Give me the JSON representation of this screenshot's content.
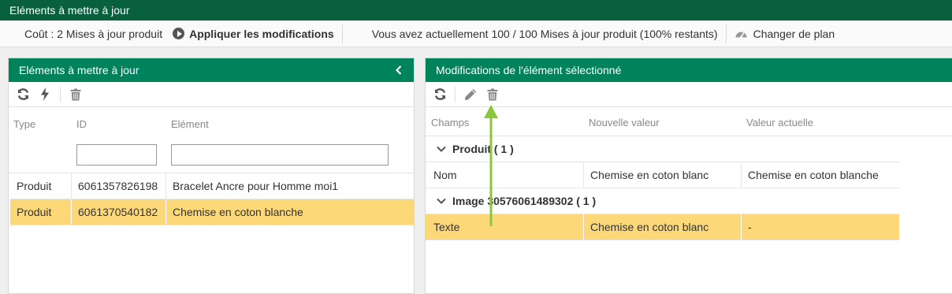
{
  "window": {
    "title": "Eléments à mettre à jour"
  },
  "toolbar": {
    "cost": "Coût : 2 Mises à jour produit",
    "apply_label": "Appliquer les modifications",
    "quota": "Vous avez actuellement 100 / 100 Mises à jour produit (100% restants)",
    "change_plan": "Changer de plan"
  },
  "left_panel": {
    "title": "Eléments à mettre à jour",
    "columns": {
      "type": "Type",
      "id": "ID",
      "element": "Elément"
    },
    "filters": {
      "id": "",
      "element": ""
    },
    "rows": [
      {
        "type": "Produit",
        "id": "6061357826198",
        "element": "Bracelet Ancre pour Homme moi1",
        "selected": false
      },
      {
        "type": "Produit",
        "id": "6061370540182",
        "element": "Chemise en coton blanche",
        "selected": true
      }
    ]
  },
  "right_panel": {
    "title": "Modifications de l'élément sélectionné",
    "columns": {
      "field": "Champs",
      "new_value": "Nouvelle valeur",
      "current_value": "Valeur actuelle"
    },
    "groups": [
      {
        "label": "Produit ( 1 )",
        "rows": [
          {
            "field": "Nom",
            "new_value": "Chemise en coton blanc",
            "current_value": "Chemise en coton blanche"
          }
        ]
      },
      {
        "label": "Image 30576061489302 ( 1 )",
        "rows": [
          {
            "field": "Texte",
            "new_value": "Chemise en coton blanc",
            "current_value": "-"
          }
        ]
      }
    ]
  },
  "colors": {
    "title_bar": "#09603f",
    "panel_header": "#00835b",
    "selected_row": "#fdd879",
    "annotation_arrow": "#8cc63f"
  },
  "icons": [
    "refresh-icon",
    "lightning-icon",
    "trash-icon",
    "pencil-icon",
    "play-icon",
    "gauge-icon",
    "chevron-left-icon",
    "chevron-down-icon"
  ]
}
